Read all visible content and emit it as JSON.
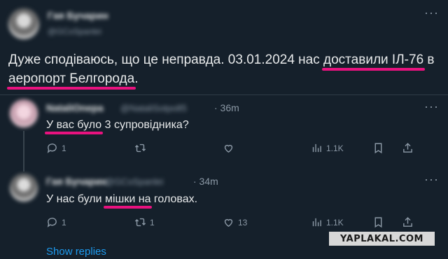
{
  "main_tweet": {
    "author_name": "Гая Бучарин",
    "author_handle": "@GCoSpanlei",
    "text_parts": {
      "p1": "Дуже сподіваюсь, що це неправда. 03.01.2024 нас ",
      "h1": "доставили ІЛ-76",
      "p2": " в ",
      "h2": "аеропорт Белгорода",
      "p3": "."
    }
  },
  "replies": [
    {
      "author_name": "NataliOnepa",
      "author_handle": "@NataliSotpo85",
      "time": "· 36m",
      "text_parts": {
        "h1": "У вас було",
        "p1": " 3 супровідника?"
      },
      "stats": {
        "reply": "1",
        "repost": "",
        "like": "",
        "views": "1.1K"
      }
    },
    {
      "author_name": "Гая Бучарин",
      "author_handle": "@GCoSpanlei",
      "time": "· 34m",
      "text_parts": {
        "p1": "У нас були ",
        "h1": "мішки на",
        "p2": " головах."
      },
      "stats": {
        "reply": "1",
        "repost": "1",
        "like": "13",
        "views": "1.1K"
      }
    }
  ],
  "show_replies": "Show replies",
  "watermark": "YAPLAKAL.COM",
  "colors": {
    "background": "#15202b",
    "highlight": "#e8127f",
    "link": "#1d9bf0"
  }
}
